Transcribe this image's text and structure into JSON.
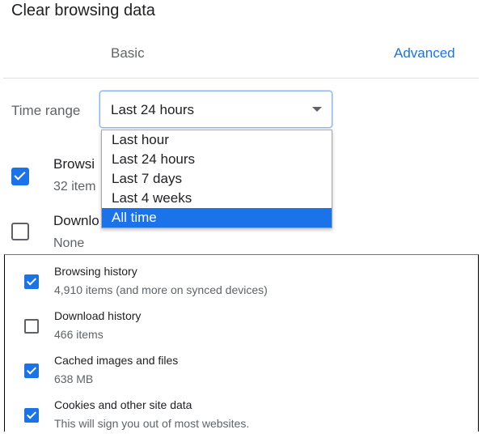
{
  "dialog": {
    "title": "Clear browsing data"
  },
  "tabs": {
    "basic": "Basic",
    "advanced": "Advanced"
  },
  "time_range": {
    "label": "Time range",
    "selected": "Last 24 hours",
    "options": [
      "Last hour",
      "Last 24 hours",
      "Last 7 days",
      "Last 4 weeks",
      "All time"
    ],
    "highlighted": "All time"
  },
  "upper_items": [
    {
      "label": "Browsi",
      "sub": "32 item",
      "checked": true
    },
    {
      "label": "Downlo",
      "sub": "None",
      "checked": false
    }
  ],
  "lower_items": [
    {
      "label": "Browsing history",
      "sub": "4,910 items (and more on synced devices)",
      "checked": true
    },
    {
      "label": "Download history",
      "sub": "466 items",
      "checked": false
    },
    {
      "label": "Cached images and files",
      "sub": "638 MB",
      "checked": true
    },
    {
      "label": "Cookies and other site data",
      "sub": "This will sign you out of most websites.",
      "checked": true
    }
  ],
  "colors": {
    "accent": "#1a73e8",
    "text": "#202124",
    "secondary": "#5f6368"
  }
}
